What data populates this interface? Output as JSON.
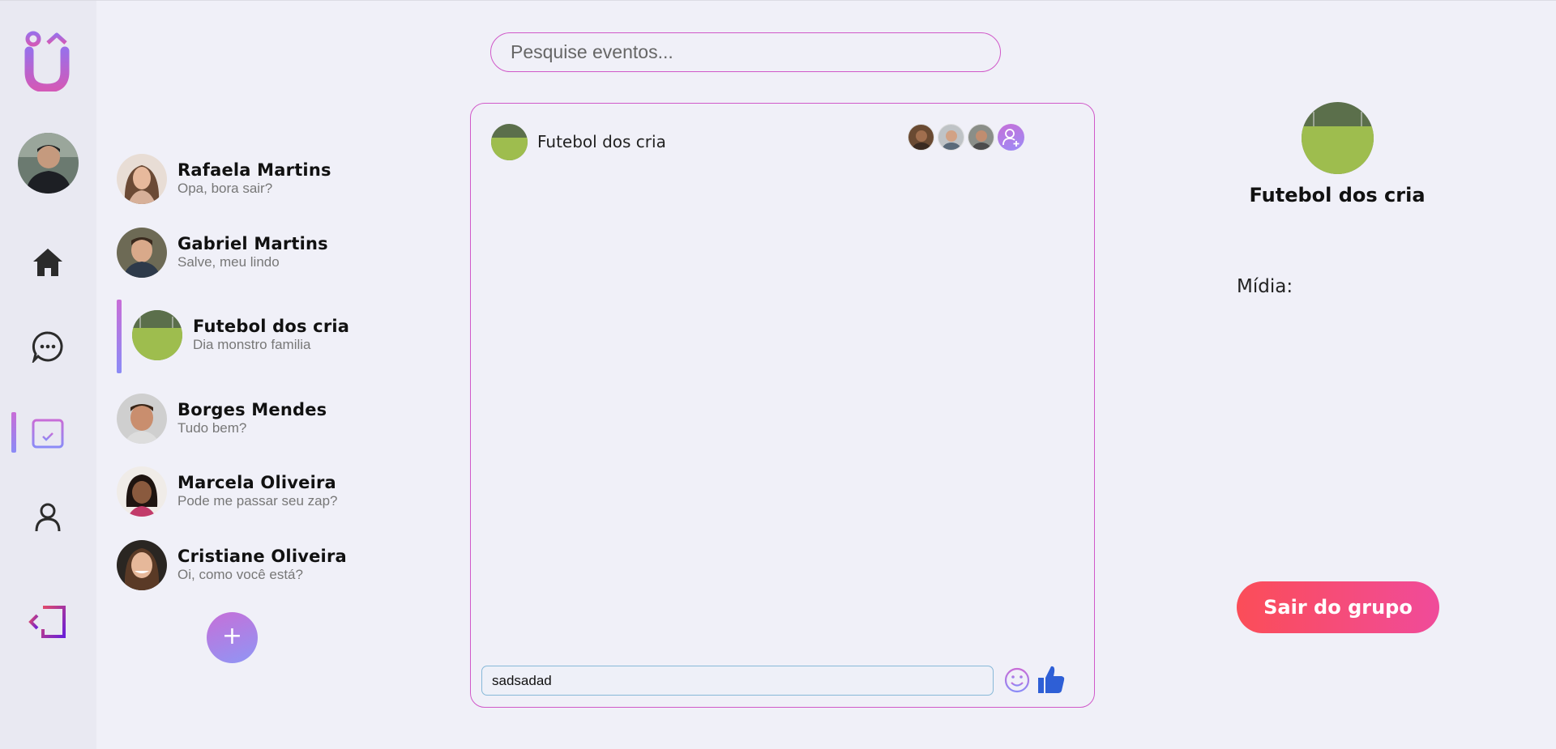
{
  "search": {
    "placeholder": "Pesquise eventos..."
  },
  "conversations": [
    {
      "name": "Rafaela Martins",
      "preview": "Opa, bora sair?"
    },
    {
      "name": "Gabriel Martins",
      "preview": "Salve, meu lindo"
    },
    {
      "name": "Futebol dos cria",
      "preview": "Dia monstro familia",
      "active": true
    },
    {
      "name": "Borges Mendes",
      "preview": "Tudo bem?"
    },
    {
      "name": "Marcela Oliveira",
      "preview": "Pode me passar seu zap?"
    },
    {
      "name": "Cristiane Oliveira",
      "preview": "Oi, como você está?"
    }
  ],
  "add_conversation_label": "+",
  "chat": {
    "title": "Futebol dos cria",
    "input_value": "sadsadad"
  },
  "info": {
    "title": "Futebol dos cria",
    "media_label": "Mídia:",
    "leave_label": "Sair do grupo"
  },
  "colors": {
    "accent_pink": "#d059c9",
    "accent_purple": "#8b8bf6",
    "leave_red": "#fb4d58",
    "like_blue": "#2e5fd6"
  },
  "icons": [
    "logo-icon",
    "home-icon",
    "chat-icon",
    "calendar-icon",
    "user-icon",
    "logout-icon",
    "emoji-icon",
    "thumbs-up-icon",
    "add-user-icon"
  ]
}
